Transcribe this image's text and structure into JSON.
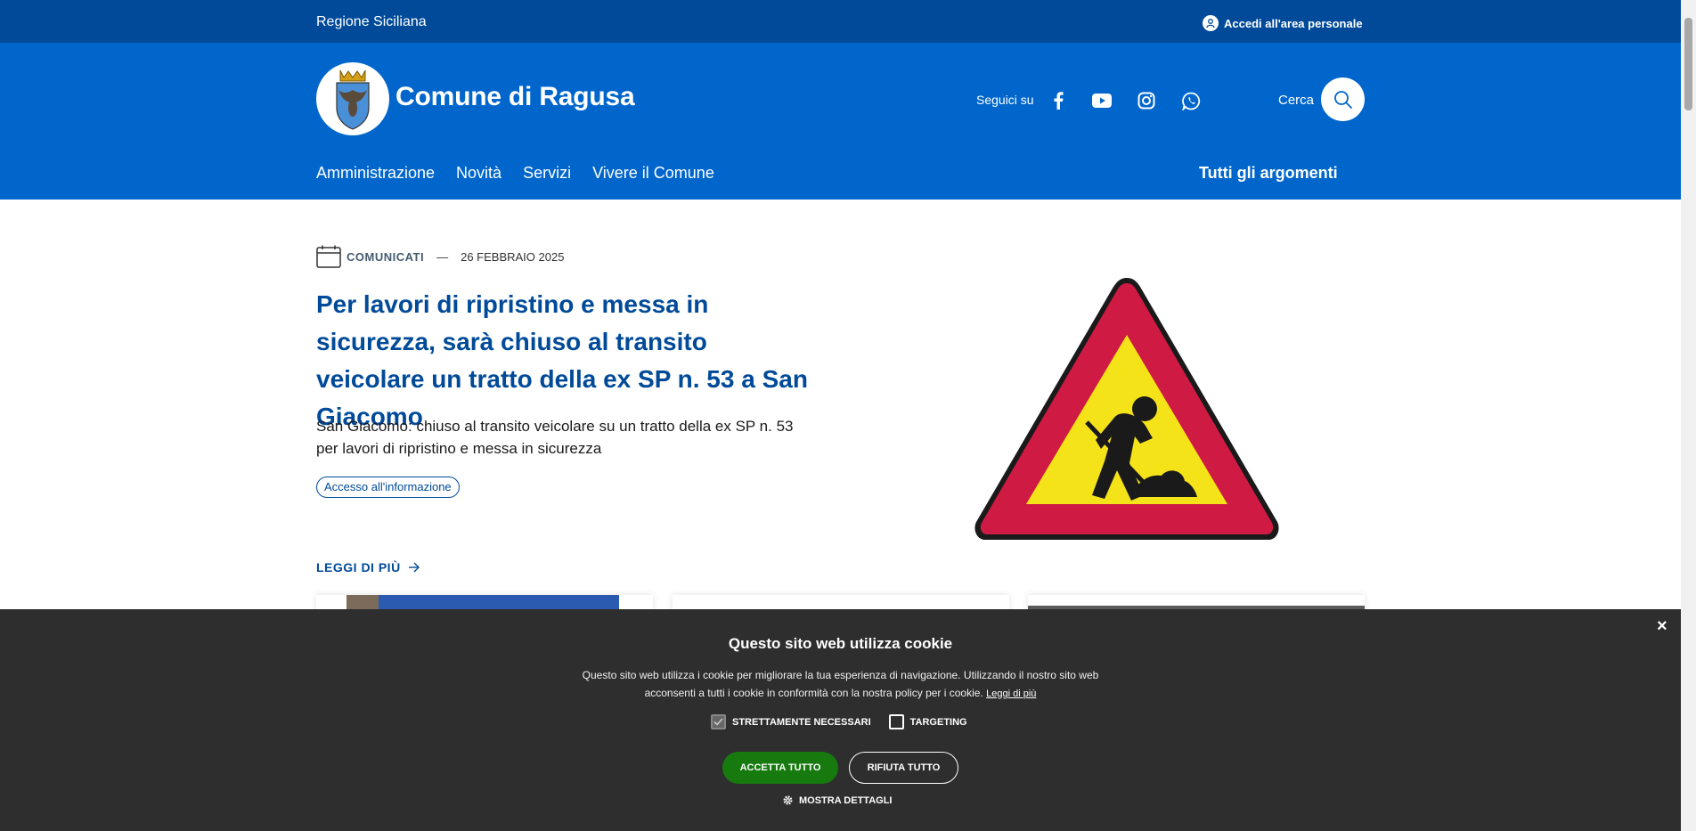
{
  "slim": {
    "region": "Regione Siciliana",
    "login": "Accedi all'area personale"
  },
  "header": {
    "brand": "Comune di Ragusa",
    "social_label": "Seguici su",
    "social_icons": [
      "facebook-icon",
      "youtube-icon",
      "instagram-icon",
      "whatsapp-icon"
    ],
    "search_label": "Cerca",
    "nav": [
      "Amministrazione",
      "Novità",
      "Servizi",
      "Vivere il Comune"
    ],
    "nav_right": "Tutti gli argomenti"
  },
  "hero": {
    "category": "COMUNICATI",
    "separator": "—",
    "date": "26 FEBBRAIO 2025",
    "title": "Per lavori di ripristino e messa in sicurezza, sarà chiuso al transito veicolare un tratto della ex SP n. 53 a San Giacomo",
    "description": "San Giacomo: chiuso al transito veicolare su un tratto della ex SP n. 53 per lavori di ripristino e messa in sicurezza",
    "chip": "Accesso all'informazione",
    "read_more": "LEGGI DI PIÙ"
  },
  "cookie": {
    "title": "Questo sito web utilizza cookie",
    "text": "Questo sito web utilizza i cookie per migliorare la tua esperienza di navigazione. Utilizzando il nostro sito web acconsenti a tutti i cookie in conformità con la nostra policy per i cookie.",
    "link": "Leggi di più",
    "necessary": "STRETTAMENTE NECESSARI",
    "targeting": "TARGETING",
    "accept": "ACCETTA TUTTO",
    "reject": "RIFIUTA TUTTO",
    "details": "MOSTRA DETTAGLI",
    "close": "×"
  },
  "colors": {
    "slim_bg": "#004a99",
    "header_bg": "#0066cc",
    "title": "#004a99",
    "cookie_bg": "#2e2e2e",
    "accept_bg": "#167a0e"
  }
}
